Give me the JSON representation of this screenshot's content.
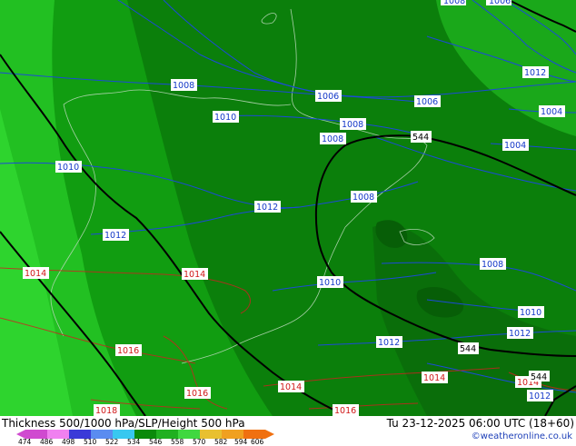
{
  "footer": {
    "title": "Thickness 500/1000 hPa/SLP/Height 500 hPa",
    "datetime": "Tu 23-12-2025 06:00 UTC (18+60)",
    "credit": "©weatheronline.co.uk"
  },
  "legend_scale": {
    "values": [
      "474",
      "486",
      "498",
      "510",
      "522",
      "534",
      "546",
      "558",
      "570",
      "582",
      "594",
      "606"
    ],
    "colors": [
      "#d04ad0",
      "#f080f0",
      "#3a3ad8",
      "#5a8cf0",
      "#38c8f0",
      "#0a8a0a",
      "#20b020",
      "#40d840",
      "#e8c030",
      "#f0a020",
      "#f07010"
    ]
  },
  "map": {
    "isobar_labels_blue": [
      {
        "text": "1008",
        "id": "top-right-1"
      },
      {
        "text": "1006",
        "id": "top-right-2"
      },
      {
        "text": "1008",
        "id": "upper-left"
      },
      {
        "text": "1006",
        "id": "upper-center"
      },
      {
        "text": "1006",
        "id": "upper-right"
      },
      {
        "text": "1012",
        "id": "right-1"
      },
      {
        "text": "1004",
        "id": "right-2"
      },
      {
        "text": "1010",
        "id": "center-top"
      },
      {
        "text": "1008",
        "id": "center-1"
      },
      {
        "text": "1008",
        "id": "center-2"
      },
      {
        "text": "1004",
        "id": "right-3"
      },
      {
        "text": "1010",
        "id": "left"
      },
      {
        "text": "1008",
        "id": "center-3"
      },
      {
        "text": "1012",
        "id": "center-4"
      },
      {
        "text": "1012",
        "id": "left-2"
      },
      {
        "text": "1008",
        "id": "right-4"
      },
      {
        "text": "1010",
        "id": "center-5"
      },
      {
        "text": "1010",
        "id": "bottom-right-1"
      },
      {
        "text": "1012",
        "id": "bottom-right-2"
      },
      {
        "text": "1012",
        "id": "bottom-center"
      },
      {
        "text": "1012",
        "id": "bottom-right-3"
      }
    ],
    "isobar_labels_red": [
      {
        "text": "1014",
        "id": "left"
      },
      {
        "text": "1014",
        "id": "center"
      },
      {
        "text": "1016",
        "id": "bottom-left"
      },
      {
        "text": "1014",
        "id": "bottom-center"
      },
      {
        "text": "1016",
        "id": "bottom-center-2"
      },
      {
        "text": "1014",
        "id": "bottom-right"
      },
      {
        "text": "1014",
        "id": "bottom-right-2"
      },
      {
        "text": "1018",
        "id": "bottom-left-2"
      },
      {
        "text": "1016",
        "id": "bottom-center-3"
      }
    ],
    "height_labels": [
      {
        "text": "544",
        "id": "upper"
      },
      {
        "text": "544",
        "id": "lower"
      },
      {
        "text": "544",
        "id": "lower-2"
      }
    ]
  }
}
